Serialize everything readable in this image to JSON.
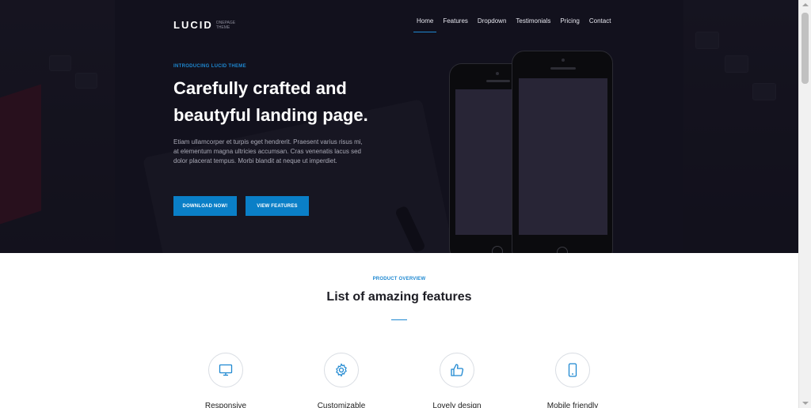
{
  "brand": {
    "name": "LUCID",
    "tagline": "ONEPAGE THEME"
  },
  "nav": {
    "items": [
      {
        "label": "Home",
        "active": true
      },
      {
        "label": "Features",
        "active": false
      },
      {
        "label": "Dropdown",
        "active": false
      },
      {
        "label": "Testimonials",
        "active": false
      },
      {
        "label": "Pricing",
        "active": false
      },
      {
        "label": "Contact",
        "active": false
      }
    ]
  },
  "hero": {
    "eyebrow": "INTRODUCING LUCID THEME",
    "headline": "Carefully crafted and beautyful landing page.",
    "body": "Etiam ullamcorper et turpis eget hendrerit. Praesent varius risus mi, at elementum magna ultricies accumsan. Cras venenatis lacus sed dolor placerat tempus. Morbi blandit at neque ut imperdiet.",
    "btn_download": "DOWNLOAD NOW!",
    "btn_features": "VIEW FEATURES"
  },
  "features": {
    "eyebrow": "PRODUCT OVERVIEW",
    "title": "List of amazing features",
    "items": [
      {
        "label": "Responsive",
        "icon": "monitor-icon"
      },
      {
        "label": "Customizable",
        "icon": "gear-icon"
      },
      {
        "label": "Lovely design",
        "icon": "thumbs-up-icon"
      },
      {
        "label": "Mobile friendly",
        "icon": "smartphone-icon"
      }
    ]
  },
  "colors": {
    "accent": "#1e88d1",
    "hero_bg": "#15141f",
    "button": "#0a7fc7"
  }
}
